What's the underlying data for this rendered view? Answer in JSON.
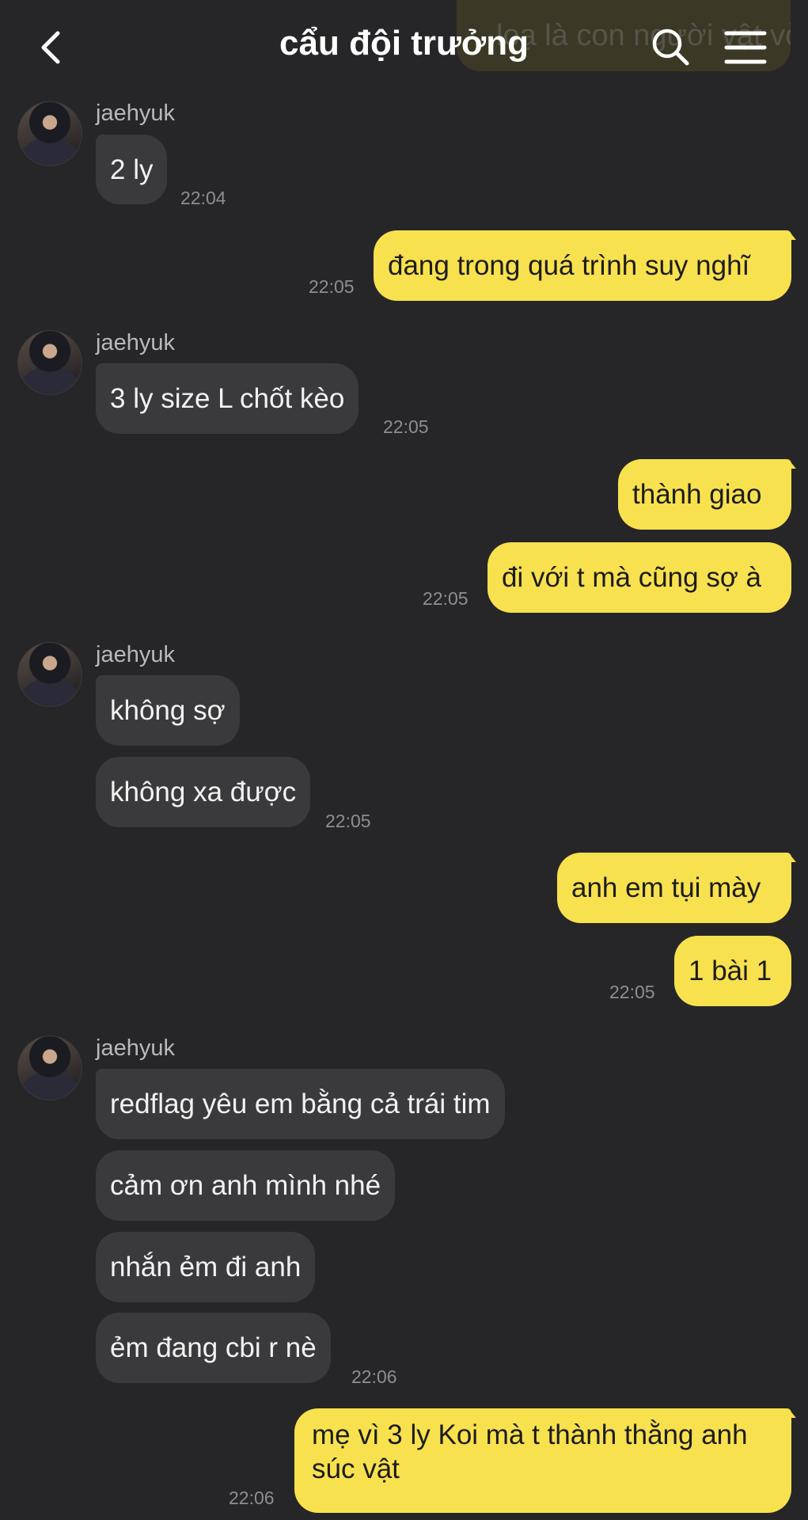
{
  "header": {
    "title": "cẩu đội trưởng",
    "ghost_text": "loạ là con người vật vờ",
    "icons": {
      "back": "chevron-left-icon",
      "search": "search-icon",
      "menu": "hamburger-menu-icon"
    }
  },
  "colors": {
    "background": "#262628",
    "incoming_bubble": "#3a3a3c",
    "outgoing_bubble": "#f8e14e"
  },
  "messages": {
    "g1": {
      "sender": "jaehyuk",
      "m1": "2 ly",
      "time": "22:04"
    },
    "o1": {
      "m1": "đang trong quá trình suy nghĩ",
      "time": "22:05"
    },
    "g2": {
      "sender": "jaehyuk",
      "m1": "3 ly size L chốt kèo",
      "time": "22:05"
    },
    "o2": {
      "m1": "thành giao",
      "m2": "đi với t mà cũng sợ à",
      "time": "22:05"
    },
    "g3": {
      "sender": "jaehyuk",
      "m1": "không sợ",
      "m2": "không xa được",
      "time": "22:05"
    },
    "o3": {
      "m1": "anh em tụi mày",
      "m2": "1 bài 1",
      "time": "22:05"
    },
    "g4": {
      "sender": "jaehyuk",
      "m1": "redflag yêu em bằng cả trái tim",
      "m2": "cảm ơn anh mình nhé",
      "m3": "nhắn ẻm đi anh",
      "m4": "ẻm đang cbi r nè",
      "time": "22:06"
    },
    "o4": {
      "m1": "mẹ vì 3 ly Koi mà t thành thằng anh súc vật",
      "time": "22:06"
    }
  }
}
